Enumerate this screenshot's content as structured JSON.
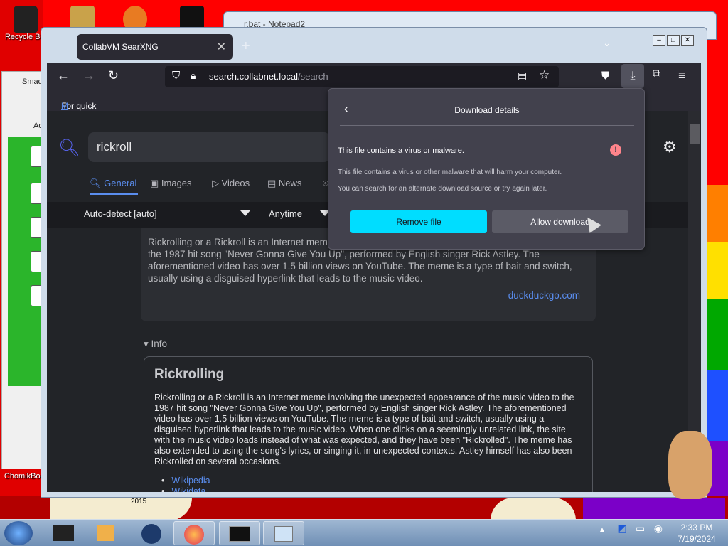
{
  "desktop": {
    "icons": [
      {
        "label": "Recycle Bin"
      },
      {
        "label": "ChomikBox"
      }
    ],
    "wall_texts": [
      "2015",
      "Smad",
      "Ad"
    ]
  },
  "notepad": {
    "title": "r.bat - Notepad2"
  },
  "browser": {
    "tab_title": "CollabVM SearXNG",
    "url_host": "search.collabnet.local",
    "url_path": "/search",
    "bookmark_hint": "For quick access, place your bookmarks here on the bookmarks toolbar.",
    "bookmark_link": "M"
  },
  "search": {
    "query": "rickroll",
    "categories": [
      {
        "label": "General",
        "active": true
      },
      {
        "label": "Images"
      },
      {
        "label": "Videos"
      },
      {
        "label": "News"
      }
    ],
    "language_filter": "Auto-detect [auto]",
    "time_filter": "Anytime"
  },
  "result": {
    "snippet": "Rickrolling or a Rickroll is an Internet meme involving the unexpected appearance of the music video to the 1987 hit song \"Never Gonna Give You Up\", performed by English singer Rick Astley. The aforementioned video has over 1.5 billion views on YouTube. The meme is a type of bait and switch, usually using a disguised hyperlink that leads to the music video.",
    "source": "duckduckgo.com",
    "info_toggle": "Info",
    "info_title": "Rickrolling",
    "info_body": "Rickrolling or a Rickroll is an Internet meme involving the unexpected appearance of the music video to the 1987 hit song \"Never Gonna Give You Up\", performed by English singer Rick Astley. The aforementioned video has over 1.5 billion views on YouTube. The meme is a type of bait and switch, usually using a disguised hyperlink that leads to the music video. When one clicks on a seemingly unrelated link, the site with the music video loads instead of what was expected, and they have been \"Rickrolled\". The meme has also extended to using the song's lyrics, or singing it, in unexpected contexts. Astley himself has also been Rickrolled on several occasions.",
    "links": [
      "Wikipedia",
      "Wikidata"
    ]
  },
  "download_panel": {
    "title": "Download details",
    "warning_title": "This file contains a virus or malware.",
    "warning_detail": "This file contains a virus or other malware that will harm your computer.",
    "warning_hint": "You can search for an alternate download source or try again later.",
    "remove_label": "Remove file",
    "allow_label": "Allow download",
    "accent_color": "#00ddff",
    "warn_color": "#ff848b"
  },
  "taskbar": {
    "time": "2:33 PM",
    "date": "7/19/2024"
  }
}
